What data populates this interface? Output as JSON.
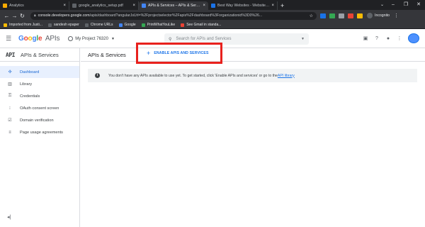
{
  "browser": {
    "tabs": [
      {
        "title": "Analytics",
        "favicon_color": "#f9ab00",
        "active": false
      },
      {
        "title": "google_analytics_setup.pdf",
        "favicon_color": "#5f6368",
        "active": false
      },
      {
        "title": "APIs & Services – APIs & Service",
        "favicon_color": "#4285f4",
        "active": true
      },
      {
        "title": "Best Way Websites - Website Stu",
        "favicon_color": "#1a73e8",
        "active": false
      }
    ],
    "url_host": "console.developers.google.com",
    "url_path": "/apis/dashboard?angularJsUrl=%2Fprojectselector%2Fapis%2Fdashboard%3Forganizationid%3D0%26...",
    "incognito_label": "Incognito",
    "bookmarks": [
      {
        "label": "Imported from Justi...",
        "color": "#fbbc04"
      },
      {
        "label": "sandesh epaper",
        "color": "#5f6368"
      },
      {
        "label": "Chrome URLs",
        "color": "#5f6368"
      },
      {
        "label": "Google",
        "color": "#4285f4"
      },
      {
        "label": "PrintWhatYouLike",
        "color": "#34a853"
      },
      {
        "label": "See Gmail in standa...",
        "color": "#ea4335"
      }
    ]
  },
  "header": {
    "logo_google": "Google",
    "logo_apis": "APIs",
    "project_name": "My Project 76320",
    "search_placeholder": "Search for APIs and Services"
  },
  "sidebar": {
    "api_mark": "API",
    "title": "APIs & Services",
    "items": [
      {
        "label": "Dashboard",
        "icon": "dashboard-icon",
        "glyph": "✣",
        "active": true
      },
      {
        "label": "Library",
        "icon": "library-icon",
        "glyph": "▥",
        "active": false
      },
      {
        "label": "Credentials",
        "icon": "key-icon",
        "glyph": "⚿",
        "active": false
      },
      {
        "label": "OAuth consent screen",
        "icon": "consent-icon",
        "glyph": "⁝",
        "active": false
      },
      {
        "label": "Domain verification",
        "icon": "checkbox-icon",
        "glyph": "☑",
        "active": false
      },
      {
        "label": "Page usage agreements",
        "icon": "settings-list-icon",
        "glyph": "≡",
        "active": false
      }
    ],
    "collapse_glyph": "◂|"
  },
  "main": {
    "title": "APIs & Services",
    "enable_button": "ENABLE APIS AND SERVICES",
    "notice_text": "You don't have any APIs available to use yet. To get started, click 'Enable APIs and services' or go to the ",
    "notice_link": "API library"
  },
  "colors": {
    "accent": "#1a73e8",
    "highlight_box": "#e8211d",
    "active_nav_bg": "#e8f0fe"
  }
}
